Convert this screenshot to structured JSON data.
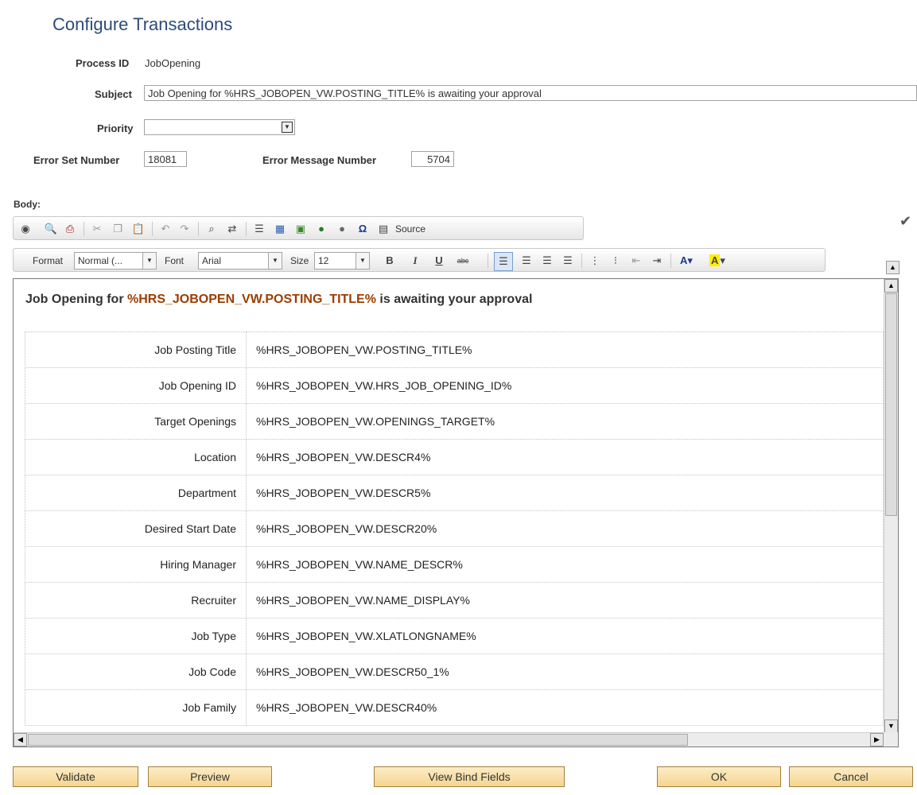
{
  "page": {
    "title": "Configure Transactions"
  },
  "form": {
    "process_id_label": "Process ID",
    "process_id_value": "JobOpening",
    "subject_label": "Subject",
    "subject_value": "Job Opening for %HRS_JOBOPEN_VW.POSTING_TITLE% is awaiting your approval",
    "priority_label": "Priority",
    "priority_value": "",
    "error_set_label": "Error Set Number",
    "error_set_value": "18081",
    "error_msg_label": "Error Message Number",
    "error_msg_value": "5704",
    "body_label": "Body:"
  },
  "toolbar": {
    "source_label": "Source",
    "format_label": "Format",
    "format_value": "Normal (...",
    "font_label": "Font",
    "font_value": "Arial",
    "size_label": "Size",
    "size_value": "12",
    "bold": "B",
    "italic": "I",
    "underline": "U",
    "strike": "abc"
  },
  "editor": {
    "heading_prefix": "Job Opening for ",
    "heading_token": "%HRS_JOBOPEN_VW.POSTING_TITLE%",
    "heading_suffix": " is awaiting your approval",
    "rows": [
      {
        "label": "Job Posting Title",
        "value": "%HRS_JOBOPEN_VW.POSTING_TITLE%"
      },
      {
        "label": "Job Opening ID",
        "value": "%HRS_JOBOPEN_VW.HRS_JOB_OPENING_ID%"
      },
      {
        "label": "Target Openings",
        "value": "%HRS_JOBOPEN_VW.OPENINGS_TARGET%"
      },
      {
        "label": "Location",
        "value": "%HRS_JOBOPEN_VW.DESCR4%"
      },
      {
        "label": "Department",
        "value": "%HRS_JOBOPEN_VW.DESCR5%"
      },
      {
        "label": "Desired Start Date",
        "value": "%HRS_JOBOPEN_VW.DESCR20%"
      },
      {
        "label": "Hiring Manager",
        "value": "%HRS_JOBOPEN_VW.NAME_DESCR%"
      },
      {
        "label": "Recruiter",
        "value": "%HRS_JOBOPEN_VW.NAME_DISPLAY%"
      },
      {
        "label": "Job Type",
        "value": "%HRS_JOBOPEN_VW.XLATLONGNAME%"
      },
      {
        "label": "Job Code",
        "value": "%HRS_JOBOPEN_VW.DESCR50_1%"
      },
      {
        "label": "Job Family",
        "value": "%HRS_JOBOPEN_VW.DESCR40%"
      }
    ]
  },
  "buttons": {
    "validate": "Validate",
    "preview": "Preview",
    "view_bind": "View Bind Fields",
    "ok": "OK",
    "cancel": "Cancel"
  }
}
